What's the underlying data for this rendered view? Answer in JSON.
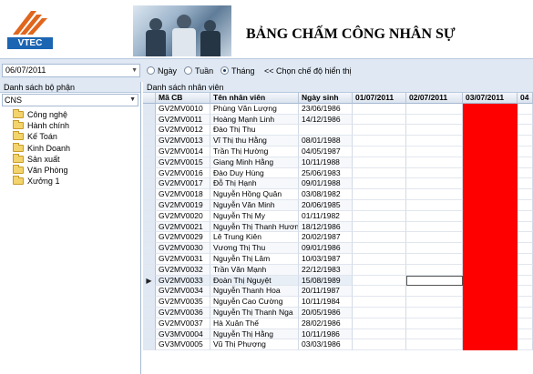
{
  "header": {
    "logo_text": "VTEC",
    "title": "BẢNG CHẤM CÔNG NHÂN SỰ"
  },
  "toolbar": {
    "date_value": "06/07/2011",
    "radio_day": "Ngày",
    "radio_week": "Tuần",
    "radio_month": "Tháng",
    "selected_mode": "Tháng",
    "hint": "<< Chọn chế độ hiển thị"
  },
  "left_panel": {
    "caption": "Danh sách bộ phận",
    "select_value": "CNS",
    "departments": [
      "Công nghệ",
      "Hành chính",
      "Kế Toán",
      "Kinh Doanh",
      "Sản xuất",
      "Văn Phòng",
      "Xưởng 1"
    ]
  },
  "right_panel": {
    "caption": "Danh sách nhân viên",
    "columns": [
      "Mã CB",
      "Tên nhân viên",
      "Ngày sinh",
      "01/07/2011",
      "02/07/2011",
      "03/07/2011",
      "04"
    ],
    "rows": [
      [
        "GV2MV0010",
        "Phùng Văn Lượng",
        "23/06/1986"
      ],
      [
        "GV2MV0011",
        "Hoàng Mạnh Linh",
        "14/12/1986"
      ],
      [
        "GV2MV0012",
        "Đào Thị Thu",
        ""
      ],
      [
        "GV2MV0013",
        "Vĩ Thị thu Hằng",
        "08/01/1988"
      ],
      [
        "GV2MV0014",
        "Trần Thị Hường",
        "04/05/1987"
      ],
      [
        "GV2MV0015",
        "Giang Minh Hằng",
        "10/11/1988"
      ],
      [
        "GV2MV0016",
        "Đào Duy Hùng",
        "25/06/1983"
      ],
      [
        "GV2MV0017",
        "Đỗ Thị Hạnh",
        "09/01/1988"
      ],
      [
        "GV2MV0018",
        "Nguyễn Hồng Quân",
        "03/08/1982"
      ],
      [
        "GV2MV0019",
        "Nguyễn Văn Minh",
        "20/06/1985"
      ],
      [
        "GV2MV0020",
        "Nguyễn Thị My",
        "01/11/1982"
      ],
      [
        "GV2MV0021",
        "Nguyễn Thị Thanh Hươn",
        "18/12/1986"
      ],
      [
        "GV2MV0029",
        "Lê Trung Kiên",
        "20/02/1987"
      ],
      [
        "GV2MV0030",
        "Vương Thị Thu",
        "09/01/1986"
      ],
      [
        "GV2MV0031",
        "Nguyễn Thị Lâm",
        "10/03/1987"
      ],
      [
        "GV2MV0032",
        "Trần Văn Mạnh",
        "22/12/1983"
      ],
      [
        "GV2MV0033",
        "Đoàn Thị Nguyệt",
        "15/08/1989"
      ],
      [
        "GV2MV0034",
        "Nguyễn Thanh Hoa",
        "20/11/1987"
      ],
      [
        "GV2MV0035",
        "Nguyễn Cao Cường",
        "10/11/1984"
      ],
      [
        "GV2MV0036",
        "Nguyễn Thị Thanh Nga",
        "20/05/1986"
      ],
      [
        "GV2MV0037",
        "Hà Xuân Thế",
        "28/02/1986"
      ],
      [
        "GV3MV0004",
        "Nguyễn Thị Hằng",
        "10/11/1986"
      ],
      [
        "GV3MV0005",
        "Vũ Thị Phượng",
        "03/03/1986"
      ]
    ],
    "current_row_index": 16,
    "highlight_column": "03/07/2011",
    "highlight_color": "#ff0000"
  },
  "colors": {
    "toolbar_bg": "#dfe8f3",
    "logo_blue": "#1c65b3",
    "logo_orange": "#e0661d"
  }
}
